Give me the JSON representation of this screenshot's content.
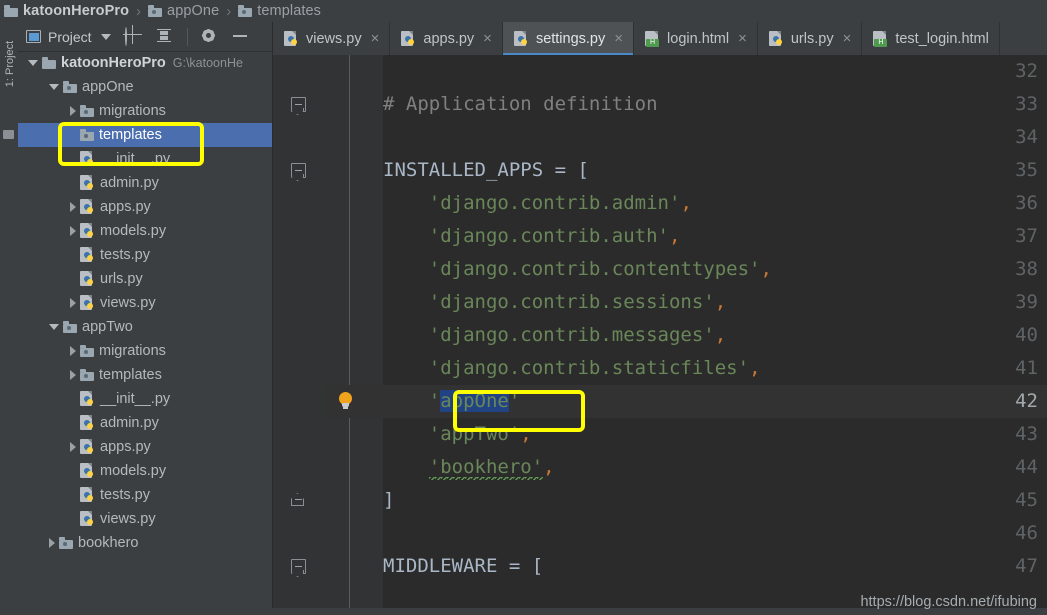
{
  "breadcrumb": {
    "items": [
      {
        "label": "katoonHeroPro",
        "icon": "folder-icon"
      },
      {
        "label": "appOne",
        "icon": "folder-icon"
      },
      {
        "label": "templates",
        "icon": "folder-icon"
      }
    ],
    "separator": "›"
  },
  "left_strip": {
    "vertical_tab": "1: Project"
  },
  "project_panel": {
    "title": "Project",
    "caret": "chevron-down-icon",
    "toolbar": [
      {
        "name": "locate-icon",
        "label": ""
      },
      {
        "name": "collapse-all-icon",
        "label": ""
      },
      {
        "name": "gear-icon",
        "label": ""
      },
      {
        "name": "minimize-icon",
        "label": ""
      }
    ],
    "tree": [
      {
        "label": "katoonHeroPro",
        "path": "G:\\katoonHe",
        "indent": 0,
        "arrow": "open",
        "icon": "folder-icon",
        "selected": false,
        "root": true
      },
      {
        "label": "appOne",
        "path": "",
        "indent": 1,
        "arrow": "open",
        "icon": "folder-dot-icon",
        "selected": false
      },
      {
        "label": "migrations",
        "path": "",
        "indent": 2,
        "arrow": "closed",
        "icon": "folder-dot-icon",
        "selected": false
      },
      {
        "label": "templates",
        "path": "",
        "indent": 2,
        "arrow": "none",
        "icon": "folder-dot-icon",
        "selected": true
      },
      {
        "label": "__init__.py",
        "path": "",
        "indent": 2,
        "arrow": "none",
        "icon": "python-file-icon",
        "selected": false
      },
      {
        "label": "admin.py",
        "path": "",
        "indent": 2,
        "arrow": "none",
        "icon": "python-file-icon",
        "selected": false
      },
      {
        "label": "apps.py",
        "path": "",
        "indent": 2,
        "arrow": "closed",
        "icon": "python-file-icon",
        "selected": false
      },
      {
        "label": "models.py",
        "path": "",
        "indent": 2,
        "arrow": "closed",
        "icon": "python-file-icon",
        "selected": false
      },
      {
        "label": "tests.py",
        "path": "",
        "indent": 2,
        "arrow": "none",
        "icon": "python-file-icon",
        "selected": false
      },
      {
        "label": "urls.py",
        "path": "",
        "indent": 2,
        "arrow": "none",
        "icon": "python-file-icon",
        "selected": false
      },
      {
        "label": "views.py",
        "path": "",
        "indent": 2,
        "arrow": "closed",
        "icon": "python-file-icon",
        "selected": false
      },
      {
        "label": "appTwo",
        "path": "",
        "indent": 1,
        "arrow": "open",
        "icon": "folder-dot-icon",
        "selected": false
      },
      {
        "label": "migrations",
        "path": "",
        "indent": 2,
        "arrow": "closed",
        "icon": "folder-dot-icon",
        "selected": false
      },
      {
        "label": "templates",
        "path": "",
        "indent": 2,
        "arrow": "closed",
        "icon": "folder-dot-icon",
        "selected": false
      },
      {
        "label": "__init__.py",
        "path": "",
        "indent": 2,
        "arrow": "none",
        "icon": "python-file-icon",
        "selected": false
      },
      {
        "label": "admin.py",
        "path": "",
        "indent": 2,
        "arrow": "none",
        "icon": "python-file-icon",
        "selected": false
      },
      {
        "label": "apps.py",
        "path": "",
        "indent": 2,
        "arrow": "closed",
        "icon": "python-file-icon",
        "selected": false
      },
      {
        "label": "models.py",
        "path": "",
        "indent": 2,
        "arrow": "none",
        "icon": "python-file-icon",
        "selected": false
      },
      {
        "label": "tests.py",
        "path": "",
        "indent": 2,
        "arrow": "none",
        "icon": "python-file-icon",
        "selected": false
      },
      {
        "label": "views.py",
        "path": "",
        "indent": 2,
        "arrow": "none",
        "icon": "python-file-icon",
        "selected": false
      },
      {
        "label": "bookhero",
        "path": "",
        "indent": 1,
        "arrow": "closed",
        "icon": "folder-dot-icon",
        "selected": false
      }
    ]
  },
  "editor": {
    "tabs": [
      {
        "label": "views.py",
        "icon": "python-file-icon",
        "active": false,
        "close": "×"
      },
      {
        "label": "apps.py",
        "icon": "python-file-icon",
        "active": false,
        "close": "×"
      },
      {
        "label": "settings.py",
        "icon": "python-file-icon",
        "active": true,
        "close": "×"
      },
      {
        "label": "login.html",
        "icon": "html-file-icon",
        "active": false,
        "close": "×"
      },
      {
        "label": "urls.py",
        "icon": "python-file-icon",
        "active": false,
        "close": "×"
      },
      {
        "label": "test_login.html",
        "icon": "html-file-icon",
        "active": false,
        "close": ""
      }
    ],
    "current_line": 42,
    "lines": [
      {
        "num": "32",
        "text": "",
        "kind": "blank",
        "fold": null
      },
      {
        "num": "33",
        "text": "# Application definition",
        "kind": "comment",
        "fold": "start-cap"
      },
      {
        "num": "34",
        "text": "",
        "kind": "blank",
        "fold": null
      },
      {
        "num": "35",
        "text": "INSTALLED_APPS = [",
        "kind": "code",
        "fold": "start"
      },
      {
        "num": "36",
        "text": "    'django.contrib.admin',",
        "kind": "string-item",
        "fold": null
      },
      {
        "num": "37",
        "text": "    'django.contrib.auth',",
        "kind": "string-item",
        "fold": null
      },
      {
        "num": "38",
        "text": "    'django.contrib.contenttypes',",
        "kind": "string-item",
        "fold": null
      },
      {
        "num": "39",
        "text": "    'django.contrib.sessions',",
        "kind": "string-item",
        "fold": null
      },
      {
        "num": "40",
        "text": "    'django.contrib.messages',",
        "kind": "string-item",
        "fold": null
      },
      {
        "num": "41",
        "text": "    'django.contrib.staticfiles',",
        "kind": "string-item",
        "fold": null
      },
      {
        "num": "42",
        "text": "    'appOne'",
        "kind": "selected-item",
        "fold": null
      },
      {
        "num": "43",
        "text": "    'appTwo',",
        "kind": "string-item",
        "fold": null
      },
      {
        "num": "44",
        "text": "    'bookhero',",
        "kind": "squiggly-item",
        "fold": null
      },
      {
        "num": "45",
        "text": "]",
        "kind": "code",
        "fold": "end"
      },
      {
        "num": "46",
        "text": "",
        "kind": "blank",
        "fold": null
      },
      {
        "num": "47",
        "text": "MIDDLEWARE = [",
        "kind": "code",
        "fold": "start"
      }
    ],
    "code_tokens": {
      "l33_comment": "# Application definition",
      "l35_name": "INSTALLED_APPS",
      "l35_eq": " = ",
      "l35_bracket": "[",
      "l36_str": "'django.contrib.admin'",
      "l37_str": "'django.contrib.auth'",
      "l38_str": "'django.contrib.contenttypes'",
      "l39_str": "'django.contrib.sessions'",
      "l40_str": "'django.contrib.messages'",
      "l41_str": "'django.contrib.staticfiles'",
      "l42_quote_open": "'",
      "l42_selected": "appOne",
      "l42_quote_close": "'",
      "l43_str": "'appTwo'",
      "l44_str": "'bookhero'",
      "l45_bracket": "]",
      "l47_name": "MIDDLEWARE",
      "l47_eq": " = ",
      "l47_bracket": "[",
      "comma": ","
    },
    "gutter_icons": {
      "line42": "lightbulb-icon"
    }
  },
  "annotations": [
    {
      "name": "highlight-box-templates",
      "color": "#ffff00"
    },
    {
      "name": "highlight-box-appone",
      "color": "#ffff00"
    }
  ],
  "watermark": "https://blog.csdn.net/ifubing",
  "colors": {
    "accent": "#4a88c7",
    "selection": "#4b6eaf",
    "string": "#6a8759",
    "keyword": "#a9b7c6",
    "punctuation": "#cc7832",
    "comment": "#808080",
    "annotation": "#ffff00",
    "editor_bg": "#2b2b2b",
    "panel_bg": "#3c3f41",
    "gutter_bg": "#313335",
    "text_selection": "#214283"
  }
}
